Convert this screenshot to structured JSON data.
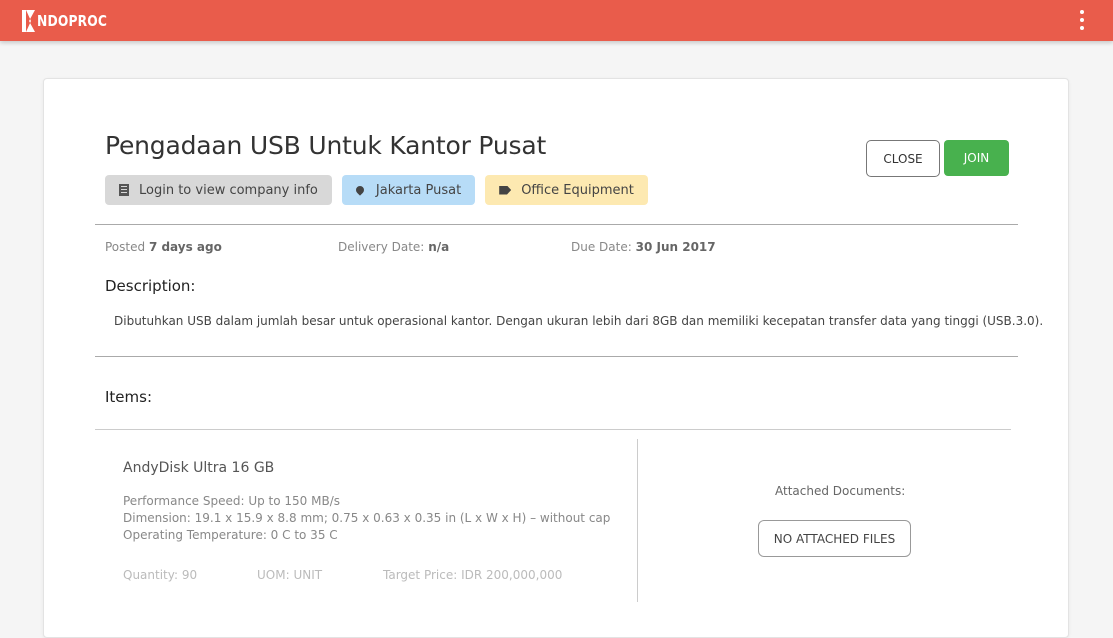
{
  "header": {
    "logo_text": "NDOPROC",
    "background_color": "#e95c4b"
  },
  "tender": {
    "title": "Pengadaan USB Untuk Kantor Pusat",
    "tags": {
      "company": "Login to view company info",
      "location": "Jakarta Pusat",
      "category": "Office Equipment"
    },
    "actions": {
      "close_label": "CLOSE",
      "join_label": "JOIN",
      "join_color": "#48b14e"
    },
    "meta": {
      "posted_label": "Posted",
      "posted_value": "7 days ago",
      "delivery_label": "Delivery Date:",
      "delivery_value": "n/a",
      "due_label": "Due Date:",
      "due_value": "30 Jun 2017"
    },
    "description_heading": "Description:",
    "description": "Dibutuhkan USB dalam jumlah besar untuk operasional kantor. Dengan ukuran lebih dari 8GB dan memiliki kecepatan transfer data yang tinggi (USB.3.0).",
    "items_heading": "Items:"
  },
  "items": [
    {
      "name": "AndyDisk Ultra 16 GB",
      "specs": [
        "Performance Speed: Up to 150 MB/s",
        "Dimension: 19.1 x 15.9 x 8.8 mm; 0.75 x 0.63 x 0.35 in (L x W x H) – without cap",
        "Operating Temperature:  0 C to 35 C"
      ],
      "quantity": "Quantity: 90",
      "uom": "UOM: UNIT",
      "target_price": "Target Price: IDR 200,000,000",
      "attached_label": "Attached Documents:",
      "no_files_label": "NO ATTACHED FILES"
    }
  ]
}
